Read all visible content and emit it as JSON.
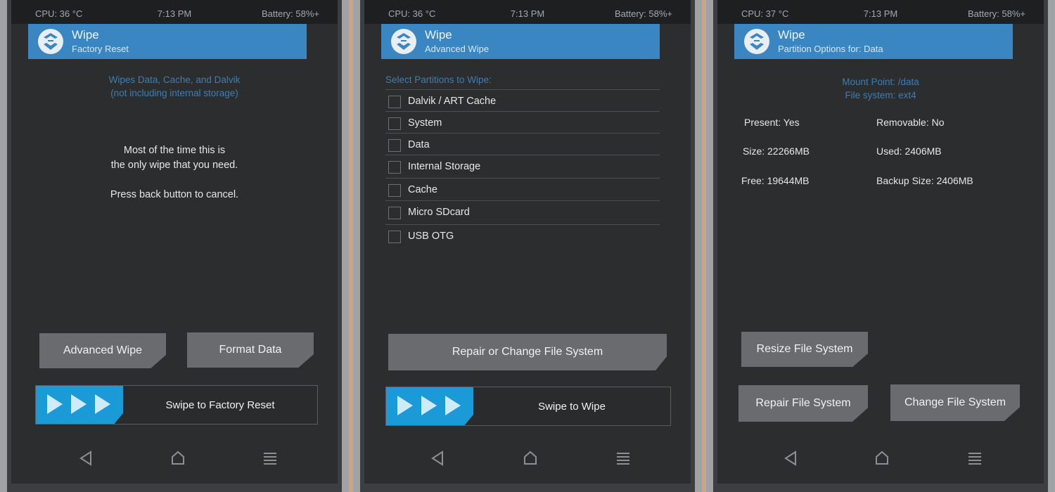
{
  "panels": [
    {
      "status": {
        "cpu": "CPU: 36 °C",
        "time": "7:13 PM",
        "battery": "Battery: 58%+"
      },
      "header": {
        "title": "Wipe",
        "subtitle": "Factory Reset"
      },
      "info": [
        "Wipes Data, Cache, and Dalvik",
        "(not including internal storage)"
      ],
      "message": [
        "Most of the time this is",
        "the only wipe that you need.",
        "Press back button to cancel."
      ],
      "buttons": {
        "advanced_wipe": "Advanced Wipe",
        "format_data": "Format Data"
      },
      "swipe_label": "Swipe to Factory Reset"
    },
    {
      "status": {
        "cpu": "CPU: 36 °C",
        "time": "7:13 PM",
        "battery": "Battery: 58%+"
      },
      "header": {
        "title": "Wipe",
        "subtitle": "Advanced Wipe"
      },
      "partitions_header": "Select Partitions to Wipe:",
      "partitions": [
        {
          "label": "Dalvik / ART Cache",
          "checked": false
        },
        {
          "label": "System",
          "checked": false
        },
        {
          "label": "Data",
          "checked": false
        },
        {
          "label": "Internal Storage",
          "checked": false
        },
        {
          "label": "Cache",
          "checked": false
        },
        {
          "label": "Micro SDcard",
          "checked": false
        },
        {
          "label": "USB OTG",
          "checked": false
        }
      ],
      "buttons": {
        "repair_change": "Repair or Change File System"
      },
      "swipe_label": "Swipe to Wipe"
    },
    {
      "status": {
        "cpu": "CPU: 37 °C",
        "time": "7:13 PM",
        "battery": "Battery: 58%+"
      },
      "header": {
        "title": "Wipe",
        "subtitle": "Partition Options for: Data"
      },
      "info": [
        "Mount Point: /data",
        "File system: ext4"
      ],
      "details": {
        "present": "Present: Yes",
        "removable": "Removable: No",
        "size": "Size: 22266MB",
        "used": "Used: 2406MB",
        "free": "Free: 19644MB",
        "backup_size": "Backup Size: 2406MB"
      },
      "buttons": {
        "resize": "Resize File System",
        "repair": "Repair File System",
        "change": "Change File System"
      }
    }
  ],
  "colors": {
    "accent_blue": "#3a86c2",
    "swipe_blue": "#1a9ad6",
    "screen_bg": "#2c2d2f",
    "button_gray": "#6a6b6e"
  },
  "icons": {
    "logo": "twrp-logo-icon",
    "back": "back-triangle-icon",
    "home": "home-icon",
    "menu": "menu-lines-icon"
  }
}
